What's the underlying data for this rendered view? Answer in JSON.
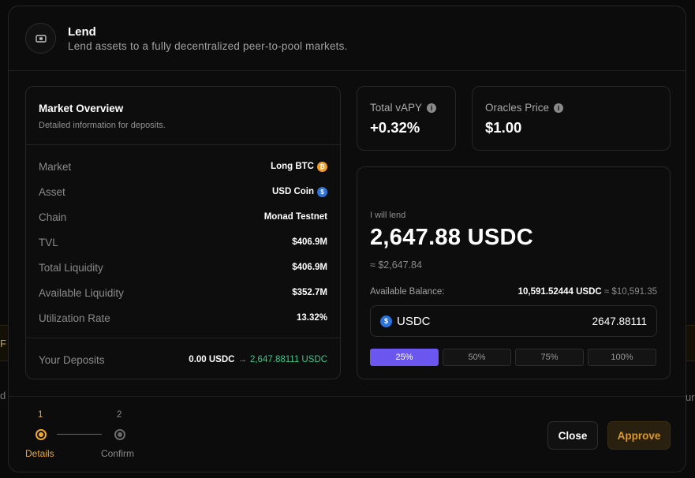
{
  "background": {
    "left_fragment": "F",
    "left_fragment2": "d",
    "right_fragment": "ur"
  },
  "header": {
    "title": "Lend",
    "subtitle": "Lend assets to a fully decentralized peer-to-pool markets.",
    "icon": "wallet-icon"
  },
  "overview": {
    "title": "Market Overview",
    "subtitle": "Detailed information for deposits.",
    "rows": [
      {
        "label": "Market",
        "value": "Long BTC",
        "icon": "btc-coin-icon"
      },
      {
        "label": "Asset",
        "value": "USD Coin",
        "icon": "usdc-coin-icon"
      },
      {
        "label": "Chain",
        "value": "Monad Testnet"
      },
      {
        "label": "TVL",
        "value": "$406.9M"
      },
      {
        "label": "Total Liquidity",
        "value": "$406.9M"
      },
      {
        "label": "Available Liquidity",
        "value": "$352.7M"
      },
      {
        "label": "Utilization Rate",
        "value": "13.32%"
      }
    ],
    "deposits": {
      "label": "Your Deposits",
      "current": "0.00 USDC",
      "arrow": "→",
      "new": "2,647.88111 USDC"
    }
  },
  "stats": {
    "apy": {
      "label": "Total vAPY",
      "value": "+0.32%"
    },
    "oracle": {
      "label": "Oracles Price",
      "value": "$1.00"
    }
  },
  "lend": {
    "label": "I will lend",
    "amount": "2,647.88 USDC",
    "approx": "≈ $2,647.84",
    "balance_label": "Available Balance:",
    "balance_value": "10,591.52444 USDC",
    "balance_usd": "≈ $10,591.35",
    "token": "USDC",
    "input_value": "2647.88111",
    "percentages": [
      "25%",
      "50%",
      "75%",
      "100%"
    ],
    "active_percentage": "25%"
  },
  "stepper": {
    "steps": [
      {
        "number": "1",
        "label": "Details",
        "active": true
      },
      {
        "number": "2",
        "label": "Confirm",
        "active": false
      }
    ]
  },
  "buttons": {
    "close": "Close",
    "approve": "Approve"
  },
  "colors": {
    "accent": "#f0a92a",
    "active_pct": "#6b57f0",
    "positive": "#3ec78a",
    "btc": "#f09b23",
    "usdc": "#2d73d8"
  }
}
